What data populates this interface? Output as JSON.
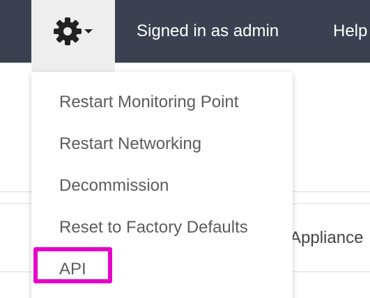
{
  "navbar": {
    "background": "#3b4150",
    "settings_icon": "gear-icon",
    "dropdown_icon": "caret-down-icon",
    "signed_in_text": "Signed in as admin",
    "help_text": "Help"
  },
  "background_content": {
    "partial_text": "Appliance"
  },
  "settings_menu": {
    "items": [
      {
        "label": "Restart Monitoring Point"
      },
      {
        "label": "Restart Networking"
      },
      {
        "label": "Decommission"
      },
      {
        "label": "Reset to Factory Defaults"
      },
      {
        "label": "API"
      }
    ],
    "highlighted_item": "API",
    "highlight_color": "#e600c8"
  }
}
